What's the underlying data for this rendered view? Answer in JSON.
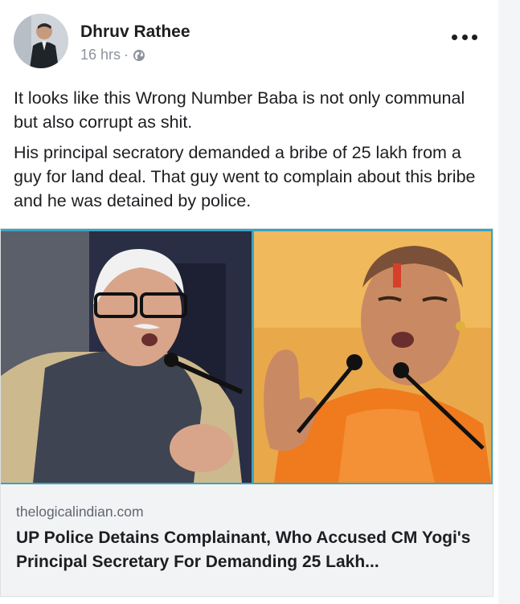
{
  "post": {
    "author": "Dhruv Rathee",
    "time": "16 hrs",
    "separator": "·",
    "privacy_icon": "globe-icon",
    "paragraphs": [
      "It looks like this Wrong Number Baba is not only communal but also corrupt as shit.",
      "His principal secratory demanded a bribe of 25 lakh from a guy for land deal. That guy went to complain about this bribe and he was detained by police."
    ]
  },
  "link": {
    "domain": "thelogicalindian.com",
    "headline": "UP Police Detains Complainant, Who Accused CM Yogi's Principal Secretary For Demanding 25 Lakh..."
  },
  "colors": {
    "text": "#1c1e21",
    "meta": "#8d949e",
    "link_bg": "#f2f3f5",
    "photo_border": "#3aa3c2",
    "saffron": "#f07a1e"
  }
}
